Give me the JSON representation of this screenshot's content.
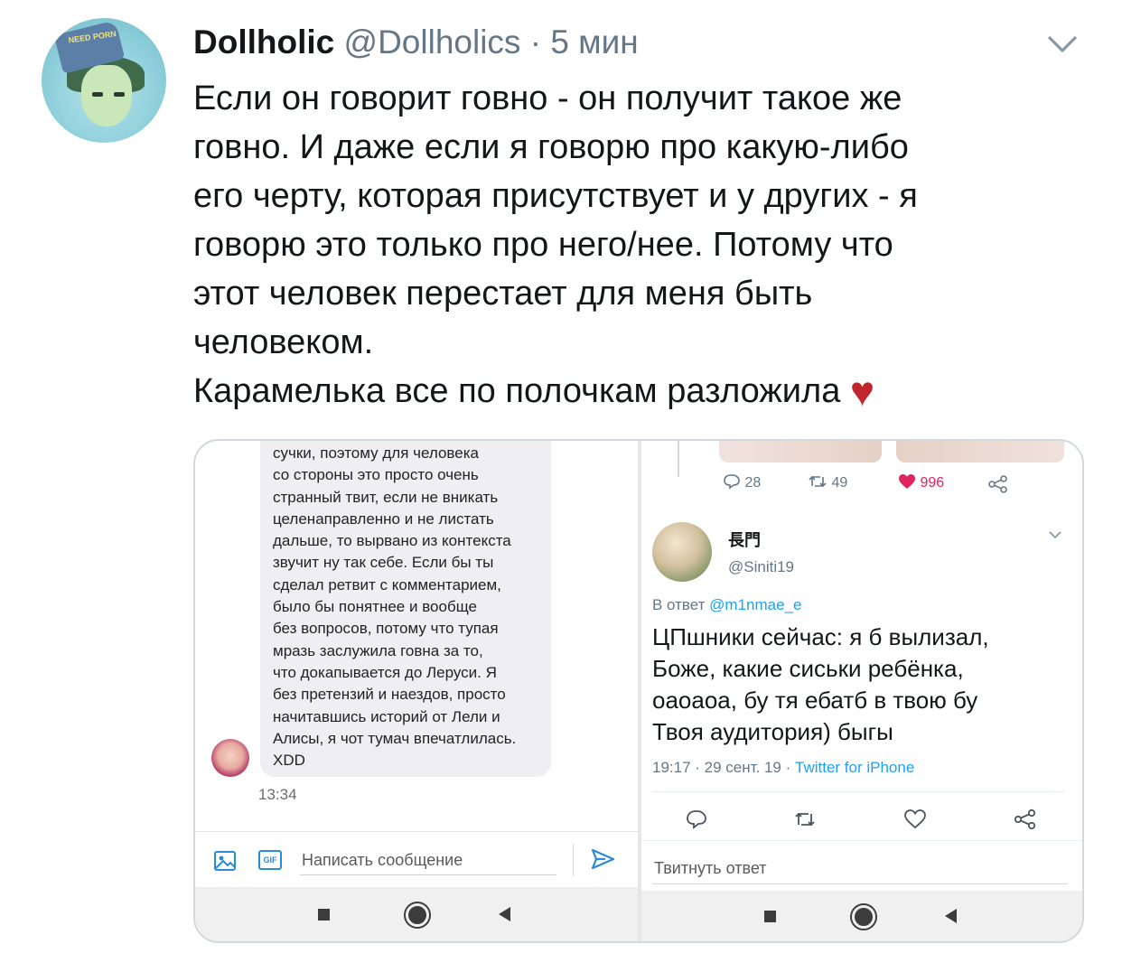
{
  "tweet": {
    "author_name": "Dollholic",
    "author_handle": "@Dollholics",
    "separator": "·",
    "time": "5 мин",
    "avatar_text": "NEED PORN",
    "text": "Если он говорит говно - он получит такое же\nговно. И даже если я говорю про какую-либо\nего черту, которая присутствует и у других - я\nговорю это только про него/нее. Потому что\nэтот человек перестает для меня быть\nчеловеком.\nКарамелька все по полочкам разложила ",
    "emoji": "♥"
  },
  "left_screenshot": {
    "message": "сучки, поэтому для человека\nсо стороны это просто очень\nстранный твит, если не вникать\nцеленаправленно и не листать\nдальше, то вырвано из контекста\nзвучит ну так себе. Если бы ты\nсделал ретвит с комментарием,\nбыло бы понятнее и вообще\nбез вопросов, потому что тупая\nмразь заслужила говна за то,\nчто докапывается до Леруси. Я\nбез претензий и наездов, просто\nначитавшись историй от Лели и\nАлисы, я чот тумач впечатлилась.\nXDD",
    "time": "13:34",
    "gif_label": "GIF",
    "input_placeholder": "Написать сообщение"
  },
  "right_screenshot": {
    "stats": {
      "replies": "28",
      "retweets": "49",
      "likes": "996"
    },
    "reply": {
      "name": "長門",
      "handle": "@Siniti19",
      "in_reply_prefix": "В ответ ",
      "in_reply_to": "@m1nmae_e",
      "text": "ЦПшники сейчас: я б вылизал,\nБоже, какие сиськи ребёнка,\nоаоаоа, бу тя ебатб в твою бу\nТвоя аудитория) быгы",
      "meta": "19:17 · 29 сент. 19 · ",
      "source": "Twitter for iPhone"
    },
    "input_placeholder": "Твитнуть ответ"
  },
  "colors": {
    "like_red": "#e0245e",
    "link_blue": "#1da1f2",
    "heart_emoji": "#c0272d"
  }
}
